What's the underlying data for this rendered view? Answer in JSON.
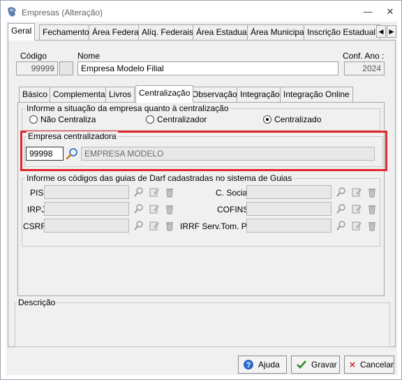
{
  "window": {
    "title": "Empresas (Alteração)"
  },
  "main_tabs": [
    {
      "label": "Geral"
    },
    {
      "label": "Fechamento"
    },
    {
      "label": "Área Federal"
    },
    {
      "label": "Alíq. Federais"
    },
    {
      "label": "Área Estadual"
    },
    {
      "label": "Área Municipal"
    },
    {
      "label": "Inscrição Estadual S"
    }
  ],
  "header": {
    "codigo_label": "Código",
    "codigo_value": "99999",
    "nome_label": "Nome",
    "nome_value": "Empresa Modelo Filial",
    "conf_ano_label": "Conf. Ano :",
    "conf_ano_value": "2024"
  },
  "sub_tabs": [
    {
      "label": "Básico"
    },
    {
      "label": "Complementar"
    },
    {
      "label": "Livros"
    },
    {
      "label": "Centralização"
    },
    {
      "label": "Observação"
    },
    {
      "label": "Integração"
    },
    {
      "label": "Integração Online"
    }
  ],
  "centralizacao": {
    "group_title": "Informe a situação da empresa quanto à centralização",
    "options": [
      {
        "label": "Não Centraliza",
        "selected": false
      },
      {
        "label": "Centralizador",
        "selected": false
      },
      {
        "label": "Centralizado",
        "selected": true
      }
    ]
  },
  "empresa_centralizadora": {
    "group_title": "Empresa centralizadora",
    "code": "99998",
    "name": "EMPRESA MODELO"
  },
  "guias": {
    "group_title": "Informe os códigos das guias de Darf cadastradas no sistema de Guias",
    "left_fields": [
      {
        "label": "PIS",
        "value": ""
      },
      {
        "label": "IRPJ",
        "value": ""
      },
      {
        "label": "CSRF",
        "value": ""
      }
    ],
    "right_fields": [
      {
        "label": "C. Social",
        "value": ""
      },
      {
        "label": "COFINS",
        "value": ""
      },
      {
        "label": "IRRF Serv.Tom. PJ",
        "value": ""
      }
    ]
  },
  "descricao": {
    "group_title": "Descrição"
  },
  "buttons": {
    "ajuda": "Ajuda",
    "gravar": "Gravar",
    "cancelar": "Cancelar"
  },
  "colors": {
    "highlight": "#e0282e",
    "window_bg": "#f0f0f0"
  }
}
